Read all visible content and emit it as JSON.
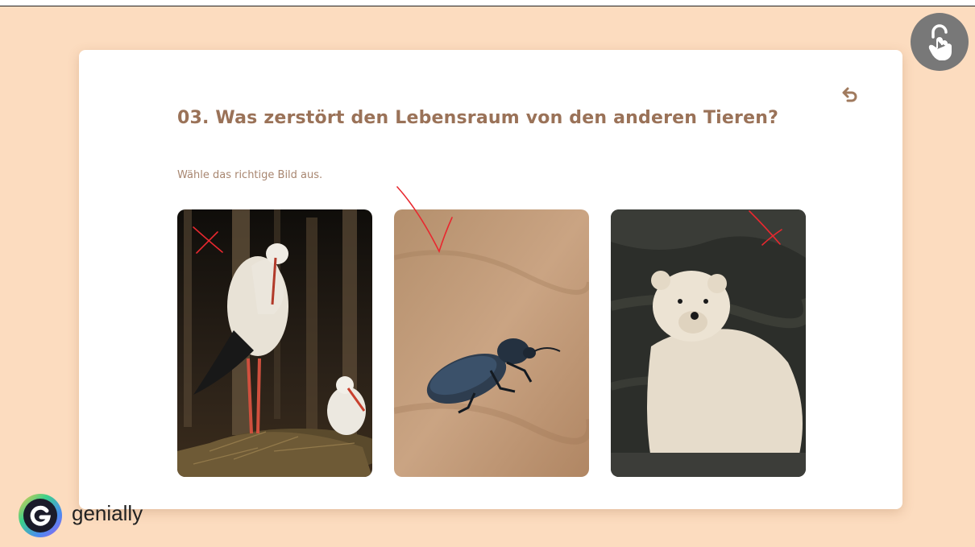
{
  "question": {
    "title": "03. Was zerstört den Lebensraum von den anderen Tieren?",
    "instruction": "Wähle das richtige Bild aus."
  },
  "options": [
    {
      "animal": "stork",
      "annotation": "cross"
    },
    {
      "animal": "beetle",
      "annotation": "check"
    },
    {
      "animal": "polar-bear",
      "annotation": "cross"
    }
  ],
  "controls": {
    "undo_icon": "undo-icon",
    "lock_icon": "lock-hand-icon"
  },
  "brand": {
    "name": "genially"
  },
  "colors": {
    "background": "#fcdcbf",
    "title": "#9a7258",
    "subtitle": "#a88670",
    "annotation": "#e8282f"
  }
}
